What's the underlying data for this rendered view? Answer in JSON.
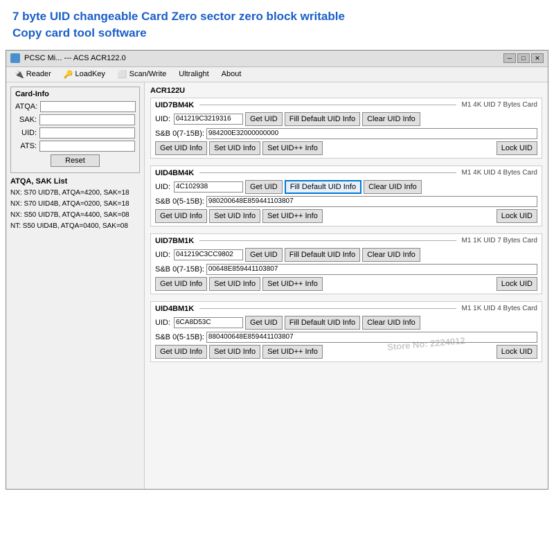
{
  "banner": {
    "title_line1": "7 byte UID changeable Card Zero sector zero block writable",
    "title_line2": "Copy card tool software"
  },
  "window": {
    "title": "PCSC Mi... --- ACS ACR122.0",
    "acr_label": "ACR122U"
  },
  "menu": {
    "items": [
      {
        "label": "Reader",
        "icon": "reader-icon"
      },
      {
        "label": "LoadKey",
        "icon": "loadkey-icon"
      },
      {
        "label": "Scan/Write",
        "icon": "scan-write-icon"
      },
      {
        "label": "Ultralight",
        "icon": null
      },
      {
        "label": "About",
        "icon": null
      }
    ]
  },
  "left_panel": {
    "card_info_label": "Card-Info",
    "fields": [
      {
        "label": "ATQA:",
        "value": ""
      },
      {
        "label": "SAK:",
        "value": ""
      },
      {
        "label": "UID:",
        "value": ""
      },
      {
        "label": "ATS:",
        "value": ""
      }
    ],
    "reset_button": "Reset",
    "atqa_sak_title": "ATQA, SAK List",
    "atqa_sak_list": [
      "NX: S70 UID7B, ATQA=4200, SAK=18",
      "NX: S70 UID4B, ATQA=0200, SAK=18",
      "NX: S50 UID7B, ATQA=4400, SAK=08",
      "NT: S50 UID4B, ATQA=0400, SAK=08"
    ]
  },
  "sections": [
    {
      "id": "UID7BM4K",
      "name": "UID7BM4K",
      "desc": "M1 4K UID 7 Bytes Card",
      "uid_value": "041219C3219316",
      "uid_highlighted": false,
      "sab_label": "S&B 0(7-15B):",
      "sab_value": "984200E32000000000",
      "get_uid": "Get UID",
      "fill_default": "Fill Default UID Info",
      "fill_highlighted": false,
      "clear_uid": "Clear UID Info",
      "get_uid_info": "Get UID Info",
      "set_uid_info": "Set UID Info",
      "set_uid_pp": "Set UID++ Info",
      "lock_uid": "Lock UID"
    },
    {
      "id": "UID4BM4K",
      "name": "UID4BM4K",
      "desc": "M1 4K UID 4 Bytes Card",
      "uid_value": "4C102938",
      "uid_highlighted": false,
      "sab_label": "S&B 0(5-15B):",
      "sab_value": "980200648E859441103807",
      "get_uid": "Get UID",
      "fill_default": "Fill Default UID Info",
      "fill_highlighted": true,
      "clear_uid": "Clear UID Info",
      "get_uid_info": "Get UID Info",
      "set_uid_info": "Set UID Info",
      "set_uid_pp": "Set UID++ Info",
      "lock_uid": "Lock UID"
    },
    {
      "id": "UID7BM1K",
      "name": "UID7BM1K",
      "desc": "M1 1K UID 7 Bytes Card",
      "uid_value": "041219C3CC9802",
      "uid_highlighted": false,
      "sab_label": "S&B 0(7-15B):",
      "sab_value": "00648E859441103807",
      "get_uid": "Get UID",
      "fill_default": "Fill Default UID Info",
      "fill_highlighted": false,
      "clear_uid": "Clear UID Info",
      "get_uid_info": "Get UID Info",
      "set_uid_info": "Set UID Info",
      "set_uid_pp": "Set UID++ Info",
      "lock_uid": "Lock UID"
    },
    {
      "id": "UID4BM1K",
      "name": "UID4BM1K",
      "desc": "M1 1K UID 4 Bytes Card",
      "uid_value": "6CA8D53C",
      "uid_highlighted": false,
      "sab_label": "S&B 0(5-15B):",
      "sab_value": "880400648E859441103807",
      "get_uid": "Get UID",
      "fill_default": "Fill Default UID Info",
      "fill_highlighted": false,
      "clear_uid": "Clear UID Info",
      "get_uid_info": "Get UID Info",
      "set_uid_info": "Set UID Info",
      "set_uid_pp": "Set UID++ Info",
      "lock_uid": "Lock UID"
    }
  ],
  "watermark": "Store No: 2224012"
}
